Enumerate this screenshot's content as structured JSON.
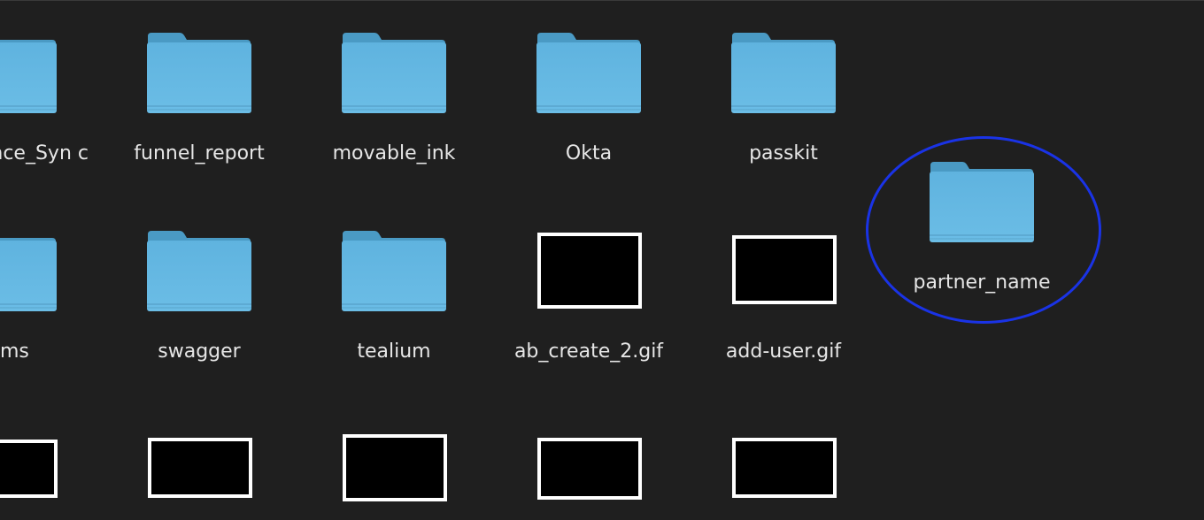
{
  "colors": {
    "background": "#1f1f1f",
    "folder_tab": "#4a9ac4",
    "folder_body": "#5fb3df",
    "label_text": "#e6e6e6",
    "highlight": "#1a33e6"
  },
  "rows": [
    {
      "items": [
        {
          "type": "folder",
          "icon": "folder-icon",
          "name": "ence_Syn c"
        },
        {
          "type": "folder",
          "icon": "folder-icon",
          "name": "funnel_report"
        },
        {
          "type": "folder",
          "icon": "folder-icon",
          "name": "movable_ink"
        },
        {
          "type": "folder",
          "icon": "folder-icon",
          "name": "Okta"
        },
        {
          "type": "folder",
          "icon": "folder-icon",
          "name": "passkit"
        }
      ]
    },
    {
      "items": [
        {
          "type": "folder",
          "icon": "folder-icon",
          "name": "ms"
        },
        {
          "type": "folder",
          "icon": "folder-icon",
          "name": "swagger"
        },
        {
          "type": "folder",
          "icon": "folder-icon",
          "name": "tealium"
        },
        {
          "type": "gif",
          "icon": "gif-thumbnail-icon",
          "name": "ab_create_2.gif"
        },
        {
          "type": "gif",
          "icon": "gif-thumbnail-icon",
          "name": "add-user.gif"
        }
      ]
    },
    {
      "items": [
        {
          "type": "gif",
          "icon": "gif-thumbnail-icon",
          "name": ""
        },
        {
          "type": "gif",
          "icon": "gif-thumbnail-icon",
          "name": ""
        },
        {
          "type": "gif",
          "icon": "gif-thumbnail-icon",
          "name": ""
        },
        {
          "type": "gif",
          "icon": "gif-thumbnail-icon",
          "name": ""
        },
        {
          "type": "gif",
          "icon": "gif-thumbnail-icon",
          "name": ""
        }
      ]
    }
  ],
  "highlighted_item": {
    "type": "folder",
    "icon": "folder-icon",
    "name": "partner_name"
  }
}
